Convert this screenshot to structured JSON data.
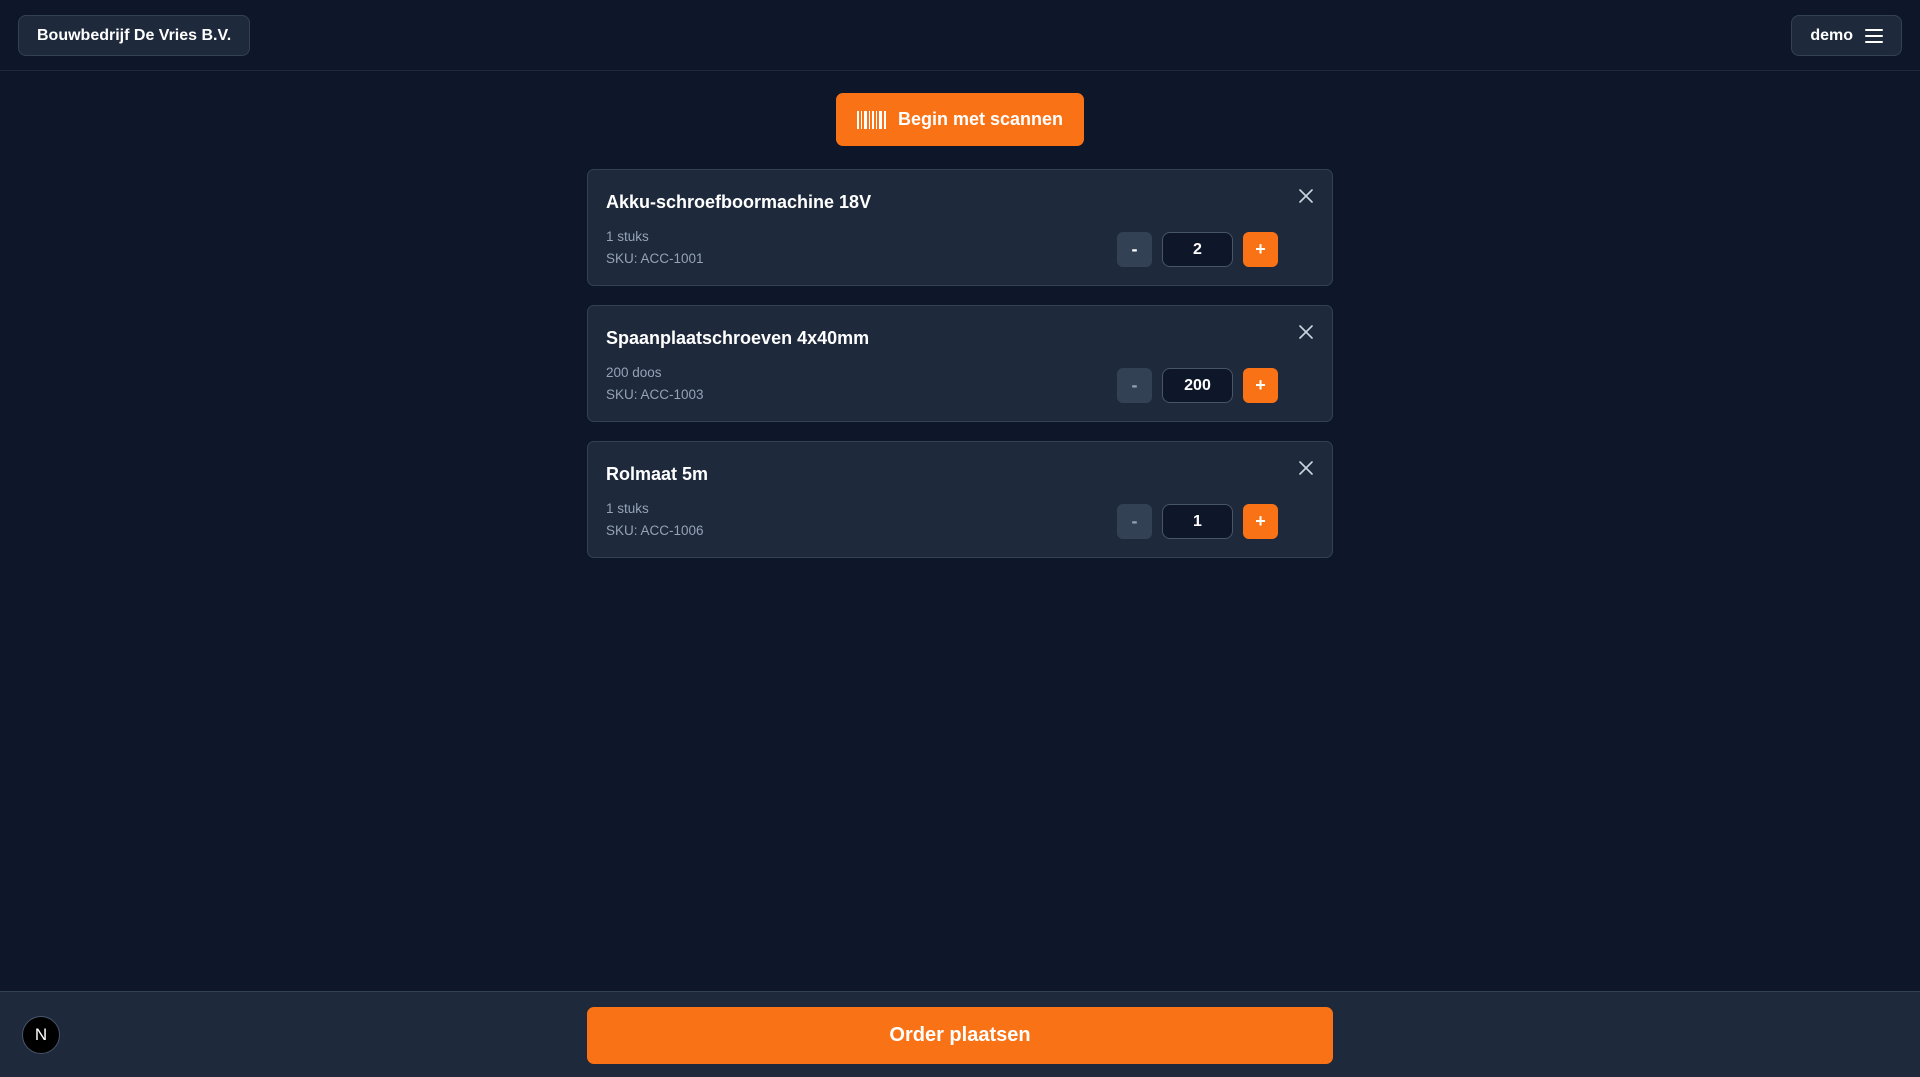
{
  "header": {
    "company": "Bouwbedrijf De Vries B.V.",
    "user": "demo"
  },
  "scan_button": {
    "label": "Begin met scannen"
  },
  "items": [
    {
      "name": "Akku-schroefboormachine 18V",
      "unit": "1 stuks",
      "sku": "SKU: ACC-1001",
      "quantity": "2",
      "minus": "-",
      "plus": "+"
    },
    {
      "name": "Spaanplaatschroeven 4x40mm",
      "unit": "200 doos",
      "sku": "SKU: ACC-1003",
      "quantity": "200",
      "minus": "-",
      "plus": "+"
    },
    {
      "name": "Rolmaat 5m",
      "unit": "1 stuks",
      "sku": "SKU: ACC-1006",
      "quantity": "1",
      "minus": "-",
      "plus": "+"
    }
  ],
  "footer": {
    "order_button": "Order plaatsen",
    "badge": "N"
  },
  "colors": {
    "accent": "#f97316",
    "background": "#0e172a",
    "card": "#1e293b",
    "border": "#334155",
    "muted_text": "#94a3b8"
  }
}
